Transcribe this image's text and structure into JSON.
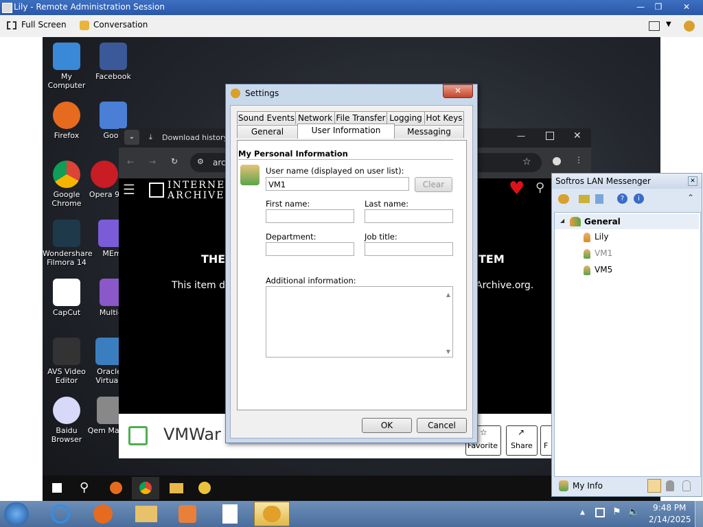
{
  "window": {
    "title": "Lily - Remote Administration Session",
    "controls": [
      "—",
      "❐",
      "✕"
    ]
  },
  "toolbar": {
    "fullscreen": "Full Screen",
    "conversation": "Conversation"
  },
  "desktop_icons": [
    {
      "label": "My Computer"
    },
    {
      "label": "Facebook"
    },
    {
      "label": "Firefox"
    },
    {
      "label": "Goog"
    },
    {
      "label": "Google Chrome"
    },
    {
      "label": "Opera 9"
    },
    {
      "label": "Wondershare Filmora 14"
    },
    {
      "label": "MEm"
    },
    {
      "label": "CapCut"
    },
    {
      "label": "Multi-M"
    },
    {
      "label": "AVS Video Editor"
    },
    {
      "label": "Oracle VirtualI"
    },
    {
      "label": "Baidu Browser"
    },
    {
      "label": "Qem Manag"
    }
  ],
  "browser": {
    "download_history": "Download history",
    "url_fragment": "arc",
    "site_name_1": "INTERNET",
    "site_name_2": "ARCHIVE",
    "headline_left": "THE",
    "headline_right": "TEM",
    "body_left": "This item do",
    "body_right": "Archive.org.",
    "banner_text": "VMWar",
    "btn_favorite": "Favorite",
    "btn_share": "Share",
    "btn_f": "F"
  },
  "settings": {
    "title": "Settings",
    "tabs_row1": [
      "Sound Events",
      "Network",
      "File Transfer",
      "Logging",
      "Hot Keys"
    ],
    "tabs_row2": [
      "General",
      "User Information",
      "Messaging"
    ],
    "section": "My Personal Information",
    "username_label": "User name (displayed on user list):",
    "username_value": "VM1",
    "clear": "Clear",
    "first_name": "First name:",
    "last_name": "Last name:",
    "department": "Department:",
    "job_title": "Job title:",
    "additional": "Additional information:",
    "ok": "OK",
    "cancel": "Cancel"
  },
  "messenger": {
    "title": "Softros LAN Messenger",
    "group": "General",
    "users": [
      "Lily",
      "VM1",
      "VM5"
    ],
    "my_info": "My Info"
  },
  "clock": {
    "time": "9:48 PM",
    "date": "2/14/2025"
  }
}
